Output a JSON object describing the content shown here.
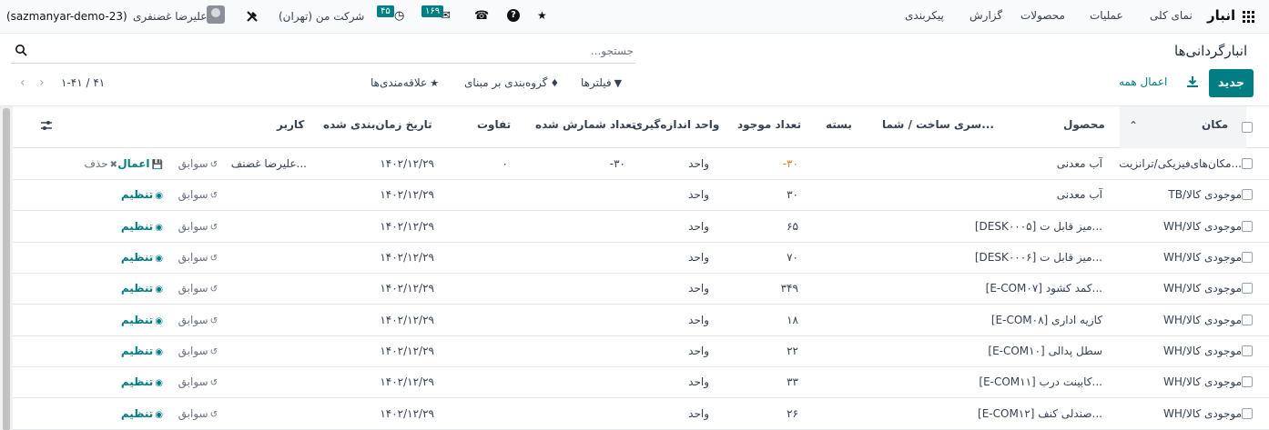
{
  "navbar": {
    "brand": "انبار",
    "menu": [
      "نمای کلی",
      "عملیات",
      "محصولات",
      "گزارش",
      "پیکربندی"
    ],
    "company": "شرکت من (تهران)",
    "user_name": "علیرضا غضنفری",
    "database": "(sazmanyar-demo-23)",
    "activity_count": "۴۵",
    "messages_count": "۱۶۹"
  },
  "control_panel": {
    "title": "انبارگردانی‌ها",
    "search_placeholder": "جستجو...",
    "new_label": "جدید",
    "apply_all_label": "اعمال همه",
    "filters_label": "فیلترها",
    "groupby_label": "گروه‌بندی بر مبنای",
    "favorites_label": "علاقه‌مندی‌ها",
    "pager": "۱-۴۱ / ۴۱"
  },
  "table": {
    "headers": {
      "location": "مکان",
      "product": "محصول",
      "lot": "سری ساخت / شما...",
      "package": "بسته",
      "on_hand": "تعداد موجود",
      "uom": "واحد اندازه‌گیری",
      "counted": "تعداد شمارش شده",
      "difference": "تفاوت",
      "scheduled": "تاریخ زمان‌بندی شده",
      "user": "کاربر"
    },
    "rows": [
      {
        "location": "مکان‌های‌فیزیکی/ترانزیت...",
        "product": "آب معدنی",
        "on_hand": "-۳۰",
        "uom": "واحد",
        "counted": "-۳۰",
        "difference": "۰",
        "date": "۱۴۰۲/۱۲/۲۹",
        "user": "علیرضا غضنف...",
        "history": "سوابق",
        "primary": "اعمال",
        "secondary": "حذف"
      },
      {
        "location": "TB/موجودی کالا",
        "product": "آب معدنی",
        "on_hand": "۳۰",
        "uom": "واحد",
        "counted": "",
        "difference": "",
        "date": "۱۴۰۲/۱۲/۲۹",
        "user": "",
        "history": "سوابق",
        "primary": "تنظیم",
        "secondary": ""
      },
      {
        "location": "WH/موجودی کالا",
        "product": "[DESK۰۰۰۵] میز قابل ت...",
        "on_hand": "۶۵",
        "uom": "واحد",
        "counted": "",
        "difference": "",
        "date": "۱۴۰۲/۱۲/۲۹",
        "user": "",
        "history": "سوابق",
        "primary": "تنظیم",
        "secondary": ""
      },
      {
        "location": "WH/موجودی کالا",
        "product": "[DESK۰۰۰۶] میز قابل ت...",
        "on_hand": "۷۰",
        "uom": "واحد",
        "counted": "",
        "difference": "",
        "date": "۱۴۰۲/۱۲/۲۹",
        "user": "",
        "history": "سوابق",
        "primary": "تنظیم",
        "secondary": ""
      },
      {
        "location": "WH/موجودی کالا",
        "product": "[E-COM۰۷] کمد کشود...",
        "on_hand": "۳۴۹",
        "uom": "واحد",
        "counted": "",
        "difference": "",
        "date": "۱۴۰۲/۱۲/۲۹",
        "user": "",
        "history": "سوابق",
        "primary": "تنظیم",
        "secondary": ""
      },
      {
        "location": "WH/موجودی کالا",
        "product": "[E-COM۰۸] کازیه اداری",
        "on_hand": "۱۸",
        "uom": "واحد",
        "counted": "",
        "difference": "",
        "date": "۱۴۰۲/۱۲/۲۹",
        "user": "",
        "history": "سوابق",
        "primary": "تنظیم",
        "secondary": ""
      },
      {
        "location": "WH/موجودی کالا",
        "product": "[E-COM۱۰] سطل پدالی",
        "on_hand": "۲۲",
        "uom": "واحد",
        "counted": "",
        "difference": "",
        "date": "۱۴۰۲/۱۲/۲۹",
        "user": "",
        "history": "سوابق",
        "primary": "تنظیم",
        "secondary": ""
      },
      {
        "location": "WH/موجودی کالا",
        "product": "[E-COM۱۱] کابینت درب...",
        "on_hand": "۳۳",
        "uom": "واحد",
        "counted": "",
        "difference": "",
        "date": "۱۴۰۲/۱۲/۲۹",
        "user": "",
        "history": "سوابق",
        "primary": "تنظیم",
        "secondary": ""
      },
      {
        "location": "WH/موجودی کالا",
        "product": "[E-COM۱۲] صندلی کنف...",
        "on_hand": "۲۶",
        "uom": "واحد",
        "counted": "",
        "difference": "",
        "date": "۱۴۰۲/۱۲/۲۹",
        "user": "",
        "history": "سوابق",
        "primary": "تنظیم",
        "secondary": ""
      }
    ]
  },
  "colors": {
    "accent": "#017e84",
    "negative": "#e67e22"
  }
}
